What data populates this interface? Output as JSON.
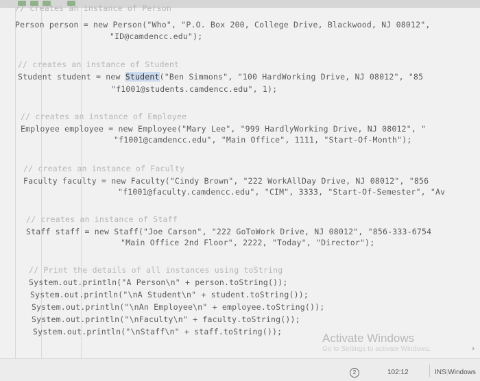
{
  "editor": {
    "lines": [
      {
        "cls": "comment",
        "text": "// creates an instance of Person"
      },
      {
        "cls": "code",
        "text": "Person person = new Person(\"Who\", \"P.O. Box 200, College Drive, Blackwood, NJ 08012\","
      },
      {
        "cls": "code",
        "text": "\"ID@camdencc.edu\");"
      },
      {
        "cls": "comment",
        "text": "// creates an instance of Student"
      },
      {
        "cls": "code",
        "text": "Student student = new Student(\"Ben Simmons\", \"100 HardWorking Drive, NJ 08012\", \"85"
      },
      {
        "cls": "code",
        "text": "\"f1001@students.camdencc.edu\", 1);"
      },
      {
        "cls": "comment",
        "text": "// creates an instance of Employee"
      },
      {
        "cls": "code",
        "text": "Employee employee = new Employee(\"Mary Lee\", \"999 HardlyWorking Drive, NJ 08012\", \""
      },
      {
        "cls": "code",
        "text": "\"f1001@camdencc.edu\", \"Main Office\", 1111, \"Start-Of-Month\");"
      },
      {
        "cls": "comment",
        "text": "// creates an instance of Faculty"
      },
      {
        "cls": "code",
        "text": "Faculty faculty = new Faculty(\"Cindy Brown\", \"222 WorkAllDay Drive, NJ 08012\", \"856"
      },
      {
        "cls": "code",
        "text": "\"f1001@faculty.camdencc.edu\", \"CIM\", 3333, \"Start-Of-Semester\", \"Av"
      },
      {
        "cls": "comment",
        "text": "// creates an instance of Staff"
      },
      {
        "cls": "code",
        "text": "Staff staff = new Staff(\"Joe Carson\", \"222 GoToWork Drive, NJ 08012\", \"856-333-6754"
      },
      {
        "cls": "code",
        "text": "\"Main Office 2nd Floor\", 2222, \"Today\", \"Director\");"
      },
      {
        "cls": "comment",
        "text": "// Print the details of all instances using toString"
      },
      {
        "cls": "code",
        "text": "System.out.println(\"A Person\\n\" + person.toString());"
      },
      {
        "cls": "code",
        "text": "System.out.println(\"\\nA Student\\n\" + student.toString());"
      },
      {
        "cls": "code",
        "text": "System.out.println(\"\\nAn Employee\\n\" + employee.toString());"
      },
      {
        "cls": "code",
        "text": "System.out.println(\"\\nFaculty\\n\" + faculty.toString());"
      },
      {
        "cls": "code",
        "text": "System.out.println(\"\\nStaff\\n\" + staff.toString());"
      }
    ]
  },
  "watermark": {
    "title": "Activate Windows",
    "subtitle": "Go to Settings to activate Windows."
  },
  "statusbar": {
    "badge": "2",
    "position": "102:12",
    "mode": "INS",
    "line_ending": "Windows"
  },
  "colors": {
    "highlight": "#c9d9ee",
    "comment": "#b5b5b5",
    "code": "#5a5a5a"
  },
  "icons": [
    "toolbar-icon-1",
    "toolbar-icon-2",
    "toolbar-icon-3",
    "toolbar-icon-4"
  ]
}
